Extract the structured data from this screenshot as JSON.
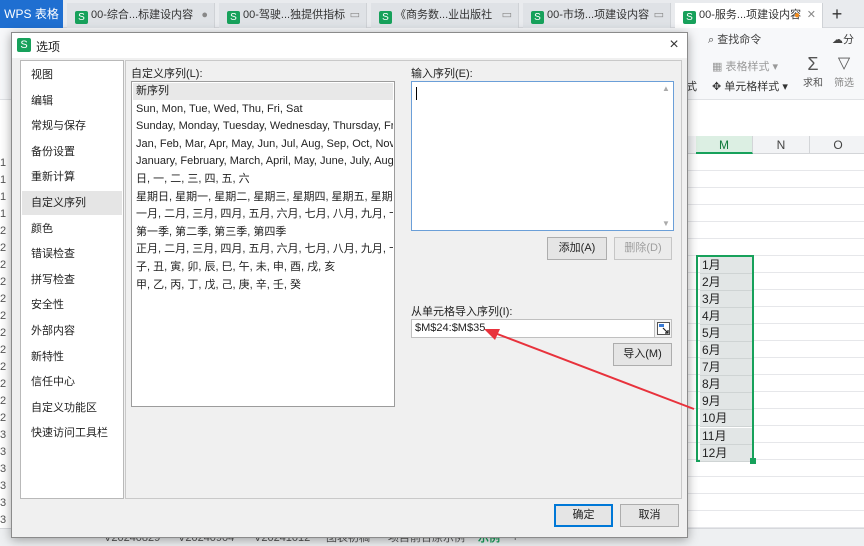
{
  "app": {
    "name": "WPS 表格",
    "tabs": [
      {
        "label": "00-综合...标建设内容",
        "active": false
      },
      {
        "label": "00-驾驶...独提供指标",
        "active": false
      },
      {
        "label": "《商务数...业出版社",
        "active": false
      },
      {
        "label": "00-市场...项建设内容",
        "active": false
      },
      {
        "label": "00-服务...项建设内容",
        "active": true
      }
    ],
    "new_tab": "+"
  },
  "ribbon": {
    "search": "查找命令",
    "share": "分",
    "table_style": "表格样式",
    "cell_style": "单元格样式",
    "sum": "求和",
    "filter": "筛选",
    "left_fragment": "式"
  },
  "sheet": {
    "columns": [
      "M",
      "N",
      "O"
    ],
    "selected_column": "M",
    "months": [
      "1月",
      "2月",
      "3月",
      "4月",
      "5月",
      "6月",
      "7月",
      "8月",
      "9月",
      "10月",
      "11月",
      "12月"
    ],
    "row_fragments": [
      "1",
      "1",
      "1",
      "1",
      "2",
      "2",
      "2",
      "2",
      "2",
      "2",
      "2",
      "2",
      "2",
      "2",
      "2",
      "2",
      "3",
      "3",
      "3",
      "3",
      "3",
      "3"
    ],
    "tabs": [
      "V20240829",
      "V20240904",
      "V20241012",
      "图表初稿",
      "项目前台原示例",
      "示例"
    ],
    "active_tab": "示例",
    "add_tab": "+"
  },
  "dialog": {
    "title": "选项",
    "close": "×",
    "nav": [
      "视图",
      "编辑",
      "常规与保存",
      "备份设置",
      "重新计算",
      "自定义序列",
      "颜色",
      "错误检查",
      "拼写检查",
      "安全性",
      "外部内容",
      "新特性",
      "信任中心",
      "自定义功能区",
      "快速访问工具栏"
    ],
    "active_nav": "自定义序列",
    "custom_list_label": "自定义序列(L):",
    "sequences": [
      "新序列",
      "Sun, Mon, Tue, Wed, Thu, Fri, Sat",
      "Sunday, Monday, Tuesday, Wednesday, Thursday, Frid...",
      "Jan, Feb, Mar, Apr, May, Jun, Jul, Aug, Sep, Oct, Nov, ...",
      "January, February, March, April, May, June, July, Augus...",
      "日, 一, 二, 三, 四, 五, 六",
      "星期日, 星期一, 星期二, 星期三, 星期四, 星期五, 星期六",
      "一月, 二月, 三月, 四月, 五月, 六月, 七月, 八月, 九月, 十月, ...",
      "第一季, 第二季, 第三季, 第四季",
      "正月, 二月, 三月, 四月, 五月, 六月, 七月, 八月, 九月, 十月, ...",
      "子, 丑, 寅, 卯, 辰, 巳, 午, 未, 申, 酉, 戌, 亥",
      "甲, 乙, 丙, 丁, 戊, 己, 庚, 辛, 壬, 癸"
    ],
    "selected_sequence": "新序列",
    "input_label": "输入序列(E):",
    "input_value": "",
    "add_button": "添加(A)",
    "delete_button": "删除(D)",
    "import_label": "从单元格导入序列(I):",
    "import_value": "$M$24:$M$35",
    "import_button": "导入(M)",
    "ok_button": "确定",
    "cancel_button": "取消"
  },
  "colors": {
    "accent_green": "#17a15b",
    "annotation_arrow": "#e8323c"
  }
}
